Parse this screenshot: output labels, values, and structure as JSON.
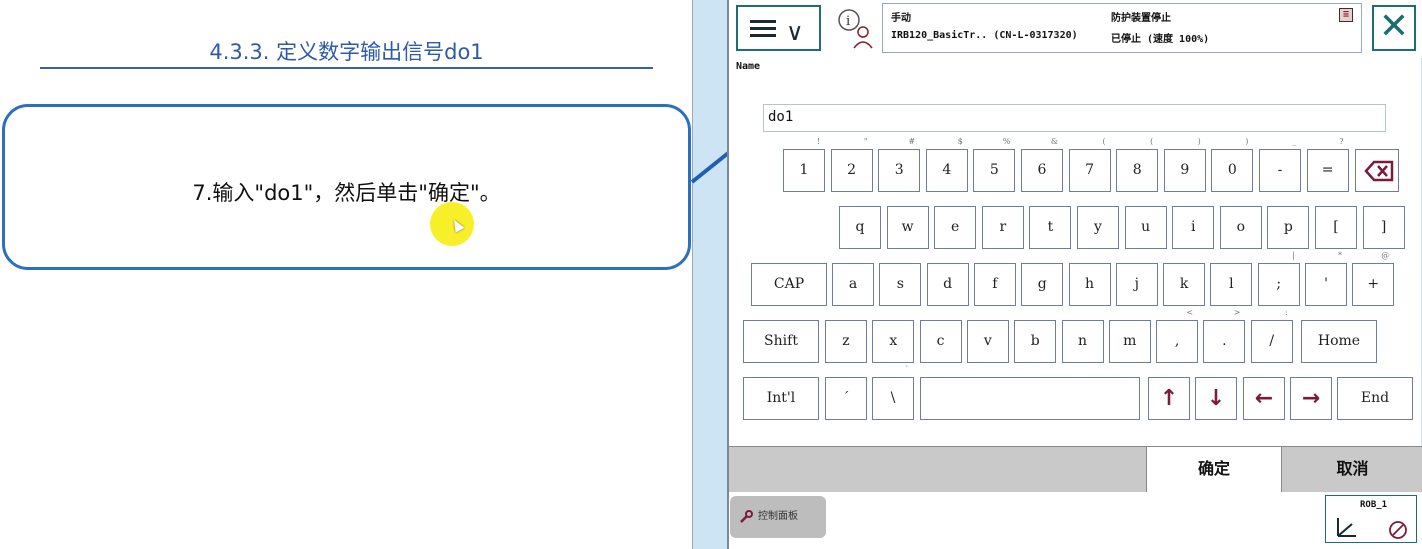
{
  "slide": {
    "title": "4.3.3. 定义数字输出信号do1",
    "instruction": "7.输入\"do1\"，然后单击\"确定\"。"
  },
  "header": {
    "mode": "手动",
    "robot": "IRB120_BasicTr..  (CN-L-0317320)",
    "safety": "防护装置停止",
    "state": "已停止 (速度 100%)"
  },
  "form": {
    "name_label": "Name",
    "name_value": "do1"
  },
  "keyboard": {
    "row1": [
      {
        "k": "1",
        "s": "!"
      },
      {
        "k": "2",
        "s": "\""
      },
      {
        "k": "3",
        "s": "#"
      },
      {
        "k": "4",
        "s": "$"
      },
      {
        "k": "5",
        "s": "%"
      },
      {
        "k": "6",
        "s": "&"
      },
      {
        "k": "7",
        "s": "("
      },
      {
        "k": "8",
        "s": "("
      },
      {
        "k": "9",
        "s": ")"
      },
      {
        "k": "0",
        "s": ")"
      },
      {
        "k": "-",
        "s": "_"
      },
      {
        "k": "=",
        "s": "?"
      }
    ],
    "row2": [
      "q",
      "w",
      "e",
      "r",
      "t",
      "y",
      "u",
      "i",
      "o",
      "p",
      "[",
      "]"
    ],
    "row3": [
      {
        "k": "CAP",
        "s": ""
      },
      {
        "k": "a",
        "s": ""
      },
      {
        "k": "s",
        "s": ""
      },
      {
        "k": "d",
        "s": ""
      },
      {
        "k": "f",
        "s": ""
      },
      {
        "k": "g",
        "s": ""
      },
      {
        "k": "h",
        "s": ""
      },
      {
        "k": "j",
        "s": ""
      },
      {
        "k": "k",
        "s": ""
      },
      {
        "k": "l",
        "s": ""
      },
      {
        "k": ";",
        "s": "|"
      },
      {
        "k": "'",
        "s": "*"
      },
      {
        "k": "+",
        "s": "@"
      }
    ],
    "row4": [
      {
        "k": "Shift",
        "s": ""
      },
      {
        "k": "z",
        "s": ""
      },
      {
        "k": "x",
        "s": ""
      },
      {
        "k": "c",
        "s": ""
      },
      {
        "k": "v",
        "s": ""
      },
      {
        "k": "b",
        "s": ""
      },
      {
        "k": "n",
        "s": ""
      },
      {
        "k": "m",
        "s": ""
      },
      {
        "k": ",",
        "s": "<"
      },
      {
        "k": ".",
        "s": ">"
      },
      {
        "k": "/",
        "s": ":"
      },
      {
        "k": "Home",
        "s": ""
      }
    ],
    "row5": [
      {
        "k": "Int'l",
        "s": "",
        "type": "text"
      },
      {
        "k": "´",
        "s": "",
        "type": "text"
      },
      {
        "k": "\\",
        "s": "`",
        "type": "text"
      },
      {
        "k": "",
        "s": "",
        "type": "space"
      },
      {
        "k": "↑",
        "s": "",
        "type": "arrow"
      },
      {
        "k": "↓",
        "s": "",
        "type": "arrow"
      },
      {
        "k": "←",
        "s": "",
        "type": "arrow"
      },
      {
        "k": "→",
        "s": "",
        "type": "arrow"
      },
      {
        "k": "End",
        "s": "",
        "type": "text"
      }
    ]
  },
  "actions": {
    "confirm": "确定",
    "cancel": "取消"
  },
  "footer": {
    "control_panel": "控制面板",
    "rob": "ROB_1"
  },
  "colors": {
    "accent": "#1b6e72",
    "arrow_key": "#7a1b3a",
    "callout_border": "#2c6fc0",
    "title": "#2e5aa8"
  }
}
